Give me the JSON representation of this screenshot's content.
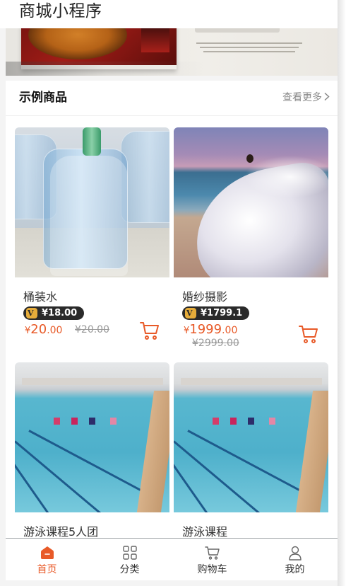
{
  "header": {
    "title": "商城小程序"
  },
  "section": {
    "title": "示例商品",
    "more_label": "查看更多"
  },
  "products": [
    {
      "name": "桶装水",
      "vip_price": "¥18.00",
      "price": {
        "currency": "¥",
        "int": "20",
        "dec": ".00"
      },
      "original_price": "¥20.00",
      "image": "water-bottles"
    },
    {
      "name": "婚纱摄影",
      "vip_price": "¥1799.1",
      "price": {
        "currency": "¥",
        "int": "1999",
        "dec": ".00"
      },
      "original_price": "¥2999.00",
      "image": "wedding-photo"
    },
    {
      "name": "游泳课程5人团",
      "image": "swimming-pool"
    },
    {
      "name": "游泳课程",
      "image": "swimming-pool"
    }
  ],
  "tabbar": {
    "items": [
      {
        "label": "首页",
        "icon": "home-icon",
        "active": true
      },
      {
        "label": "分类",
        "icon": "grid-icon",
        "active": false
      },
      {
        "label": "购物车",
        "icon": "cart-icon",
        "active": false
      },
      {
        "label": "我的",
        "icon": "user-icon",
        "active": false
      }
    ]
  },
  "colors": {
    "accent": "#e85a28",
    "vip_bg": "#2a2a2a",
    "vip_badge": "#e6ac3a"
  }
}
